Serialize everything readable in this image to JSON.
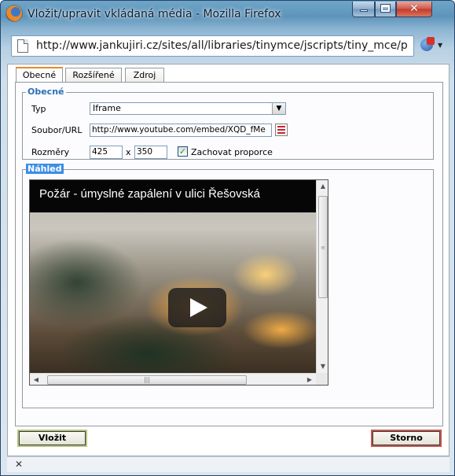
{
  "window": {
    "title": "Vložit/upravit vkládaná média - Mozilla Firefox",
    "url": "http://www.jankujiri.cz/sites/all/libraries/tinymce/jscripts/tiny_mce/pl"
  },
  "tabs": [
    {
      "label": "Obecné",
      "active": true
    },
    {
      "label": "Rozšířené",
      "active": false
    },
    {
      "label": "Zdroj",
      "active": false
    }
  ],
  "general": {
    "legend": "Obecné",
    "type_label": "Typ",
    "type_value": "Iframe",
    "url_label": "Soubor/URL",
    "url_value": "http://www.youtube.com/embed/XQD_fMe",
    "size_label": "Rozměry",
    "width": "425",
    "times": "x",
    "height": "350",
    "keep_ratio_label": "Zachovat proporce",
    "keep_ratio_checked": true
  },
  "preview": {
    "legend": "Náhled",
    "video_title": "Požár - úmyslné zapálení  v ulici Řešovská"
  },
  "buttons": {
    "insert": "Vložit",
    "cancel": "Storno"
  },
  "statusbar": {
    "close_glyph": "✕"
  },
  "icons": {
    "app": "firefox-icon",
    "page": "page-icon",
    "browse": "browse-icon",
    "play": "play-icon"
  }
}
